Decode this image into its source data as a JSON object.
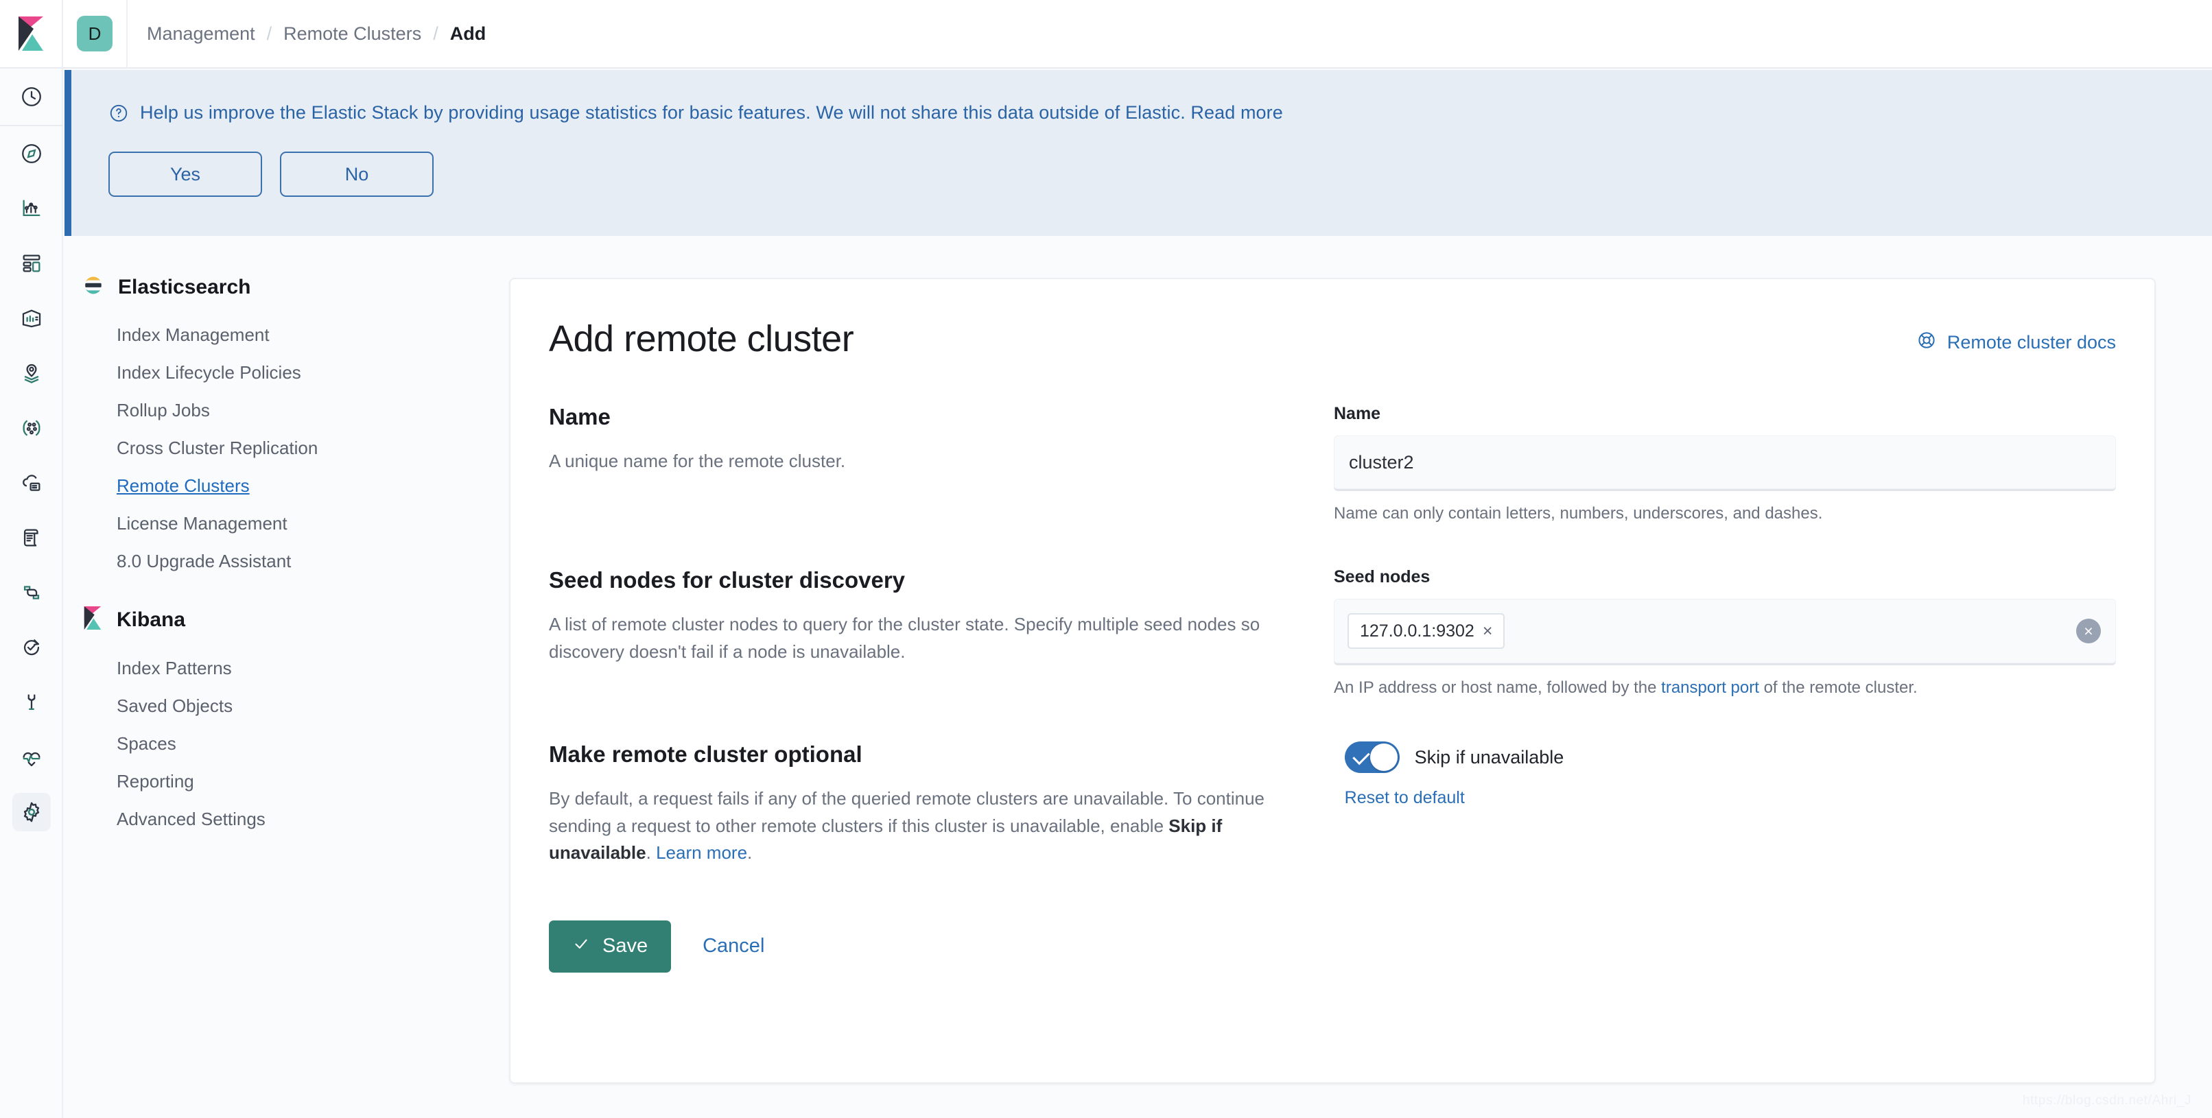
{
  "topbar": {
    "logo_icon": "kibana-logo-icon",
    "space_initial": "D",
    "breadcrumbs": [
      {
        "label": "Management",
        "active": false
      },
      {
        "label": "Remote Clusters",
        "active": false
      },
      {
        "label": "Add",
        "active": true
      }
    ],
    "separator": "/"
  },
  "rail": {
    "items": [
      {
        "name": "recently-viewed",
        "icon": "clock-icon"
      },
      {
        "name": "discover",
        "icon": "compass-icon"
      },
      {
        "name": "visualize",
        "icon": "bar-chart-icon"
      },
      {
        "name": "dashboard",
        "icon": "dashboard-grid-icon"
      },
      {
        "name": "canvas",
        "icon": "canvas-icon"
      },
      {
        "name": "maps",
        "icon": "map-marker-layers-icon"
      },
      {
        "name": "graph",
        "icon": "graph-nodes-icon"
      },
      {
        "name": "infrastructure",
        "icon": "cloud-server-icon"
      },
      {
        "name": "logs",
        "icon": "scroll-document-icon"
      },
      {
        "name": "apm",
        "icon": "apm-layers-icon"
      },
      {
        "name": "uptime",
        "icon": "uptime-check-icon"
      },
      {
        "name": "dev-tools",
        "icon": "wrench-icon"
      },
      {
        "name": "monitoring",
        "icon": "heartbeat-icon"
      },
      {
        "name": "management",
        "icon": "gear-icon"
      }
    ]
  },
  "banner": {
    "icon": "question-circle-icon",
    "message": "Help us improve the Elastic Stack by providing usage statistics for basic features. We will not share this data outside of Elastic. Read more",
    "yes_label": "Yes",
    "no_label": "No",
    "accent_color": "#2e6cb0",
    "background_color": "#e6edf4"
  },
  "sidenav": {
    "groups": [
      {
        "title": "Elasticsearch",
        "icon": "elasticsearch-logo-icon",
        "items": [
          {
            "label": "Index Management",
            "active": false
          },
          {
            "label": "Index Lifecycle Policies",
            "active": false
          },
          {
            "label": "Rollup Jobs",
            "active": false
          },
          {
            "label": "Cross Cluster Replication",
            "active": false
          },
          {
            "label": "Remote Clusters",
            "active": true
          },
          {
            "label": "License Management",
            "active": false
          },
          {
            "label": "8.0 Upgrade Assistant",
            "active": false
          }
        ]
      },
      {
        "title": "Kibana",
        "icon": "kibana-logo-icon",
        "items": [
          {
            "label": "Index Patterns",
            "active": false
          },
          {
            "label": "Saved Objects",
            "active": false
          },
          {
            "label": "Spaces",
            "active": false
          },
          {
            "label": "Reporting",
            "active": false
          },
          {
            "label": "Advanced Settings",
            "active": false
          }
        ]
      }
    ]
  },
  "panel": {
    "title": "Add remote cluster",
    "docs_link": "Remote cluster docs",
    "docs_icon": "life-ring-help-icon",
    "name_section": {
      "title": "Name",
      "description": "A unique name for the remote cluster.",
      "field_label": "Name",
      "value": "cluster2",
      "placeholder": "",
      "help_text": "Name can only contain letters, numbers, underscores, and dashes."
    },
    "seed_section": {
      "title": "Seed nodes for cluster discovery",
      "description": "A list of remote cluster nodes to query for the cluster state. Specify multiple seed nodes so discovery doesn't fail if a node is unavailable.",
      "field_label": "Seed nodes",
      "pills": [
        "127.0.0.1:9302"
      ],
      "pill_remove_glyph": "×",
      "clear_glyph": "×",
      "help_text_before": "An IP address or host name, followed by the ",
      "help_link": "transport port",
      "help_text_after": " of the remote cluster."
    },
    "optional_section": {
      "title": "Make remote cluster optional",
      "description_part1": "By default, a request fails if any of the queried remote clusters are unavailable. To continue sending a request to other remote clusters if this cluster is unavailable, enable ",
      "description_bold": "Skip if unavailable",
      "description_part2": ". ",
      "description_link": "Learn more",
      "description_part3": ".",
      "toggle_label": "Skip if unavailable",
      "toggle_on": true,
      "reset_label": "Reset to default",
      "toggle_color": "#3171b8"
    },
    "actions": {
      "save_label": "Save",
      "save_icon": "check-icon",
      "save_color": "#327f73",
      "cancel_label": "Cancel"
    }
  },
  "watermark": "https://blog.csdn.net/Ahri_J"
}
